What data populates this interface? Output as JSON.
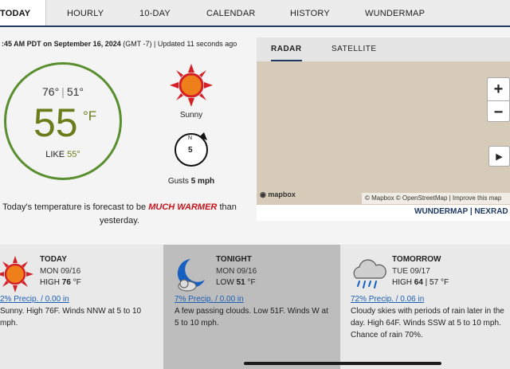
{
  "tabs": [
    {
      "label": "TODAY",
      "active": true
    },
    {
      "label": "HOURLY",
      "active": false
    },
    {
      "label": "10-DAY",
      "active": false
    },
    {
      "label": "CALENDAR",
      "active": false
    },
    {
      "label": "HISTORY",
      "active": false
    },
    {
      "label": "WUNDERMAP",
      "active": false
    }
  ],
  "current": {
    "timestamp_bold": ":45 AM PDT on September 16, 2024",
    "timestamp_rest": " (GMT -7) | Updated 11 seconds ago",
    "high": "76°",
    "low": "51°",
    "temp": "55",
    "unit": "°F",
    "feels_prefix": "LIKE ",
    "feels_value": "55°",
    "condition": "Sunny",
    "wind_dir": "N",
    "wind_speed": "5",
    "gusts_prefix": "Gusts ",
    "gusts_value": "5 mph",
    "forecast_prefix": "Today's temperature is forecast to be ",
    "forecast_emphasis": "MUCH WARMER",
    "forecast_suffix": " than yesterday."
  },
  "radar": {
    "tabs": [
      "RADAR",
      "SATELLITE"
    ],
    "zoom_in": "+",
    "zoom_out": "−",
    "play": "▶",
    "logo": "mapbox",
    "attribution": "© Mapbox © OpenStreetMap | Improve this map",
    "link_wundermap": "WUNDERMAP",
    "link_sep": " | ",
    "link_nexrad": "NEXRAD"
  },
  "cards": [
    {
      "title": "TODAY",
      "date": "MON 09/16",
      "hl_prefix": "HIGH ",
      "hl_value": "76",
      "hl_suffix": " °F",
      "precip": "2% Precip. / 0.00 in",
      "text": "Sunny. High 76F. Winds NNW at 5 to 10 mph.",
      "icon": "sun-icon"
    },
    {
      "title": "TONIGHT",
      "date": "MON 09/16",
      "hl_prefix": "LOW ",
      "hl_value": "51",
      "hl_suffix": " °F",
      "precip": "7% Precip. / 0.00 in",
      "text": "A few passing clouds. Low 51F. Winds W at 5 to 10 mph.",
      "icon": "moon-cloud-icon"
    },
    {
      "title": "TOMORROW",
      "date": "TUE 09/17",
      "hl_prefix": "HIGH ",
      "hl_value": "64",
      "hl_suffix": " | 57 °F",
      "precip": "72% Precip. / 0.06 in",
      "text": "Cloudy skies with periods of rain later in the day. High 64F. Winds SSW at 5 to 10 mph. Chance of rain 70%.",
      "icon": "rain-cloud-icon"
    }
  ],
  "colors": {
    "accent_navy": "#1f3a63",
    "temp_green": "#6b7d1a",
    "ring_green": "#5a8f2f",
    "warm_red": "#c6131b",
    "sun_red": "#d42027",
    "sun_orange": "#ef7f1a",
    "link_blue": "#1a5fb4"
  }
}
